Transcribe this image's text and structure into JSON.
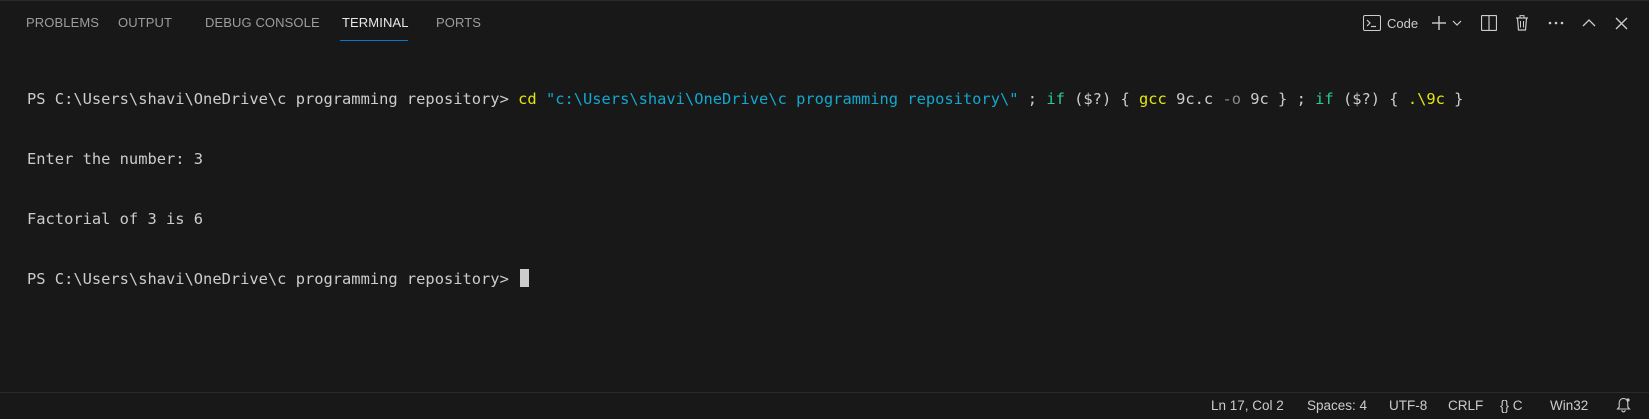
{
  "tabs": [
    {
      "label": "PROBLEMS",
      "active": false
    },
    {
      "label": "OUTPUT",
      "active": false
    },
    {
      "label": "DEBUG CONSOLE",
      "active": false
    },
    {
      "label": "TERMINAL",
      "active": true
    },
    {
      "label": "PORTS",
      "active": false
    }
  ],
  "toolbar": {
    "terminal_profile_label": "Code",
    "icons": [
      "terminal-icon",
      "plus-icon",
      "chevron-down-icon",
      "split-icon",
      "trash-icon",
      "ellipsis-icon",
      "chevron-up-icon",
      "close-icon"
    ]
  },
  "terminal": {
    "line1": {
      "prompt": "PS C:\\Users\\shavi\\OneDrive\\c programming repository> ",
      "cd": "cd",
      "path": "\"c:\\Users\\shavi\\OneDrive\\c programming repository\\\"",
      "semi1": " ; ",
      "if1": "if",
      "cond1": " ($?) { ",
      "gcc": "gcc",
      "src": " 9c.c ",
      "flag": "-o",
      "out": " 9c } ; ",
      "if2": "if",
      "cond2": " ($?) { ",
      "run": ".\\9c",
      "end": " }"
    },
    "line2": "Enter the number: 3",
    "line3": "Factorial of 3 is 6",
    "line4_prompt": "PS C:\\Users\\shavi\\OneDrive\\c programming repository> "
  },
  "statusbar": {
    "position": "Ln 17, Col 2",
    "spaces": "Spaces: 4",
    "encoding": "UTF-8",
    "eol": "CRLF",
    "language_braces": "{}",
    "language": "C",
    "platform": "Win32"
  },
  "colors": {
    "background": "#181818",
    "active_tab_underline": "#0078d4",
    "command": "#e5e510",
    "string": "#11a8cd",
    "keyword": "#23d18b"
  }
}
